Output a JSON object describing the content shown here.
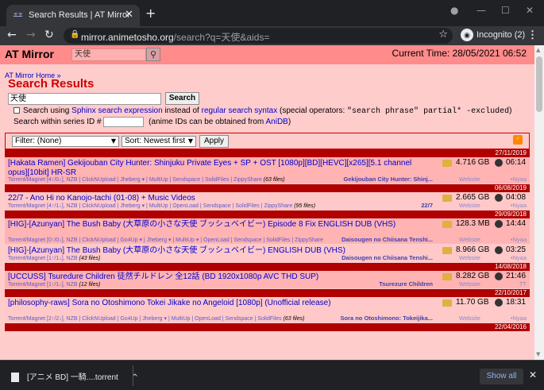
{
  "browser": {
    "tab_title": "Search Results | AT Mirror",
    "tab_favicon": "ܫܫ",
    "url_host": "mirror.animetosho.org",
    "url_path": "/search?q=天使&aids=",
    "incognito_label": "Incognito (2)"
  },
  "site": {
    "logo": "AT Mirror",
    "top_search_value": "天使",
    "current_time": "Current Time: 28/05/2021 06:52"
  },
  "search": {
    "breadcrumb": "AT Mirror Home »",
    "title": "Search Results",
    "query": "天使",
    "search_button": "Search",
    "opt_prefix": "Search using",
    "opt_sphinx": "Sphinx search expression",
    "opt_middle": "instead of",
    "opt_regular": "regular search syntax",
    "opt_ops_prefix": "(special operators:",
    "opt_ops": "\"search phrase\" partial* -excluded",
    "opt_ops_suffix": ")",
    "sid_label": "Search within series ID #",
    "sid_note_prefix": "(anime IDs can be obtained from",
    "sid_note_link": "AniDB",
    "sid_note_suffix": ")"
  },
  "filters": {
    "filter_value": "Filter: (None)",
    "sort_value": "Sort: Newest first",
    "apply_label": "Apply"
  },
  "entries": [
    {
      "date": "27/11/2019",
      "title": "[Hakata Ramen] Gekijouban City Hunter: Shinjuku Private Eyes + SP + OST [1080p][BD][HEVC][x265][5.1 channel opus][10bit] HR-SR",
      "links": "Torrent/Magnet [4↑/0↓], NZB | ClickNUpload | Jheberg ▾ | MultiUp | Sendspace | SolidFiles | ZippyShare",
      "files": "(63 files)",
      "anime": "Gekijouban City Hunter: Shinj...",
      "size": "4.716 GB",
      "time": "06:14",
      "website": "Website",
      "source": "•Nyaa"
    },
    {
      "date": "06/08/2019",
      "title": "22/7 - Ano Hi no Kanojo-tachi (01-08) + Music Videos",
      "links": "Torrent/Magnet [4↑/1↓], NZB | ClickNUpload | Jheberg ▾ | MultiUp | OpenLoad | Sendspace | SolidFiles | ZippyShare",
      "files": "(95 files)",
      "anime": "22/7",
      "size": "2.665 GB",
      "time": "04:08",
      "website": "Website",
      "source": "•Nyaa"
    },
    {
      "date": "29/09/2018",
      "title": "[HIG]-[Azunyan] The Bush Baby (大草原の小さな天使 ブッシュベイビー) Episode 8 Fix ENGLISH DUB (VHS)",
      "links": "Torrent/Magnet [0↑/0↓], NZB | ClickNUpload | Go4Up ▾ | Jheberg ▾ | MultiUp ▾ | OpenLoad | Sendspace | SolidFiles | ZippyShare",
      "files": "",
      "anime": "Daisougen no Chiisana Tenshi...",
      "size": "128.3 MB",
      "time": "14:44",
      "website": "Website",
      "source": "•Nyaa"
    },
    {
      "date": "",
      "title": "[HIG]-[Azunyan] The Bush Baby (大草原の小さな天使 ブッシュベイビー) ENGLISH DUB (VHS)",
      "links": "Torrent/Magnet [1↑/1↓], NZB",
      "files": "(43 files)",
      "anime": "Daisougen no Chiisana Tenshi...",
      "size": "8.966 GB",
      "time": "03:25",
      "website": "Website",
      "source": "•Nyaa"
    },
    {
      "date": "14/08/2018",
      "title": "[UCCUSS] Tsuredure Children 徒然チルドレン 全12話 (BD 1920x1080p AVC THD SUP)",
      "links": "Torrent/Magnet [1↑/1↓], NZB",
      "files": "(12 files)",
      "anime": "Tsurezure Children",
      "size": "8.282 GB",
      "time": "21:46",
      "website": "Website",
      "source": "TT"
    },
    {
      "date": "22/10/2017",
      "title": "[philosophy-raws] Sora no Otoshimono Tokei Jikake no Angeloid [1080p] (Unofficial release)",
      "links": "Torrent/Magnet [2↑/2↓], NZB | ClickNUpload | Go4Up | Jheberg ▾ | MultiUp | OpenLoad | Sendspace | SolidFiles",
      "files": "(63 files)",
      "anime": "Sora no Otoshimono: Tokeijika...",
      "size": "11.70 GB",
      "time": "18:31",
      "website": "Website",
      "source": "•Nyaa"
    }
  ],
  "last_date": "22/04/2016",
  "download_bar": {
    "item_label": "[アニメ BD] 一騎....torrent",
    "show_all": "Show all"
  }
}
